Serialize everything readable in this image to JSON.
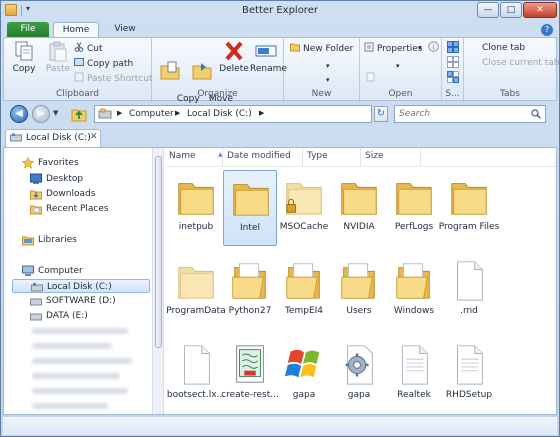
{
  "window": {
    "title": "Better Explorer"
  },
  "window_controls": {
    "minimize": "—",
    "maximize": "□",
    "close": "✕"
  },
  "qat": {
    "dropdown": "▾"
  },
  "ribbon_tabs": {
    "file": "File",
    "home": "Home",
    "view": "View"
  },
  "clipboard": {
    "label": "Clipboard",
    "copy": "Copy",
    "paste": "Paste",
    "cut": "Cut",
    "copy_path": "Copy path",
    "paste_shortcut": "Paste Shortcut"
  },
  "organize": {
    "label": "Organize",
    "copy_to": "Copy\nto",
    "move_to": "Move\nto",
    "delete": "Delete",
    "rename": "Rename"
  },
  "new_group": {
    "label": "New",
    "new_folder": "New Folder"
  },
  "open_group": {
    "label": "Open",
    "properties": "Properties"
  },
  "select_group": {
    "label": "S..."
  },
  "tabs_group": {
    "label": "Tabs",
    "clone_tab": "Clone tab",
    "close_current_tab": "Close current tab"
  },
  "address": {
    "crumbs": [
      "Computer",
      "Local Disk (C:)"
    ],
    "separator": "▶"
  },
  "search": {
    "placeholder": "Search"
  },
  "doc_tab": {
    "label": "Local Disk (C:)",
    "close": "✕"
  },
  "nav": {
    "favorites": "Favorites",
    "desktop": "Desktop",
    "downloads": "Downloads",
    "recent_places": "Recent Places",
    "libraries": "Libraries",
    "computer": "Computer",
    "local_disk": "Local Disk (C:)",
    "software": "SOFTWARE (D:)",
    "data": "DATA (E:)"
  },
  "columns": {
    "name": "Name",
    "date_modified": "Date modified",
    "type": "Type",
    "size": "Size"
  },
  "files": [
    {
      "name": "inetpub",
      "kind": "folder"
    },
    {
      "name": "Intel",
      "kind": "folder",
      "selected": true
    },
    {
      "name": "MSOCache",
      "kind": "folder-locked"
    },
    {
      "name": "NVIDIA",
      "kind": "folder"
    },
    {
      "name": "PerfLogs",
      "kind": "folder"
    },
    {
      "name": "Program Files",
      "kind": "folder"
    },
    {
      "name": "ProgramData",
      "kind": "folder-light"
    },
    {
      "name": "Python27",
      "kind": "folder-open"
    },
    {
      "name": "TempEI4",
      "kind": "folder-open"
    },
    {
      "name": "Users",
      "kind": "folder-open"
    },
    {
      "name": "Windows",
      "kind": "folder-open"
    },
    {
      "name": ".rnd",
      "kind": "file"
    },
    {
      "name": "bootsect.lx...",
      "kind": "file"
    },
    {
      "name": "create-rest...",
      "kind": "script"
    },
    {
      "name": "gapa",
      "kind": "windows-logo"
    },
    {
      "name": "gapa",
      "kind": "gear"
    },
    {
      "name": "Realtek",
      "kind": "file-lines"
    },
    {
      "name": "RHDSetup",
      "kind": "file-lines"
    }
  ],
  "colors": {
    "file_tab": "#2f8c35",
    "selection": "#cfe3fa",
    "folder": "#f4d47f",
    "accent": "#2b68b6"
  }
}
